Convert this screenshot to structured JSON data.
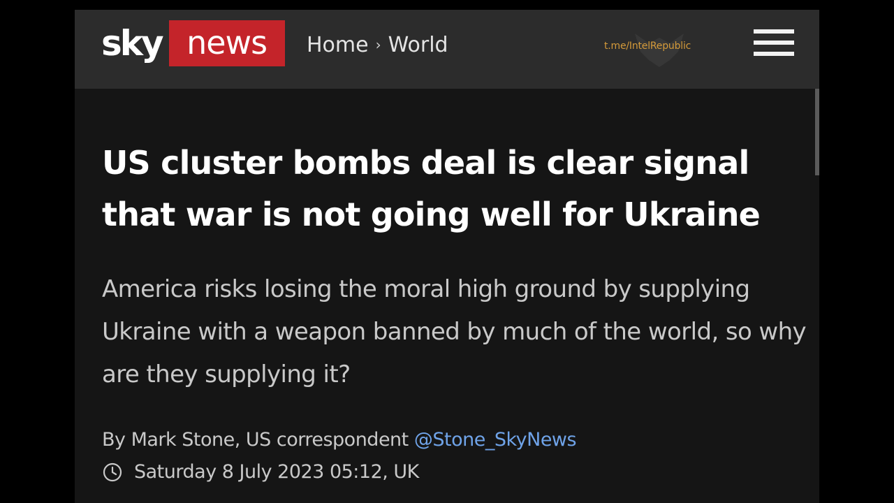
{
  "header": {
    "logo": {
      "sky": "sky",
      "news": "news"
    },
    "breadcrumb": {
      "items": [
        "Home",
        "World"
      ],
      "separator": "›"
    },
    "watermark": "t.me/IntelRepublic",
    "menu_icon": "hamburger-menu-icon"
  },
  "article": {
    "headline": "US cluster bombs deal is clear signal that war is not going well for Ukraine",
    "standfirst": "America risks losing the moral high ground by supplying Ukraine with a weapon banned by much of the world, so why are they supplying it?",
    "byline": {
      "text": "By Mark Stone, US correspondent",
      "handle": "@Stone_SkyNews"
    },
    "timestamp": "Saturday 8 July 2023 05:12, UK",
    "timestamp_icon": "clock-icon"
  },
  "colors": {
    "page_background": "#151515",
    "header_background": "#2c2c2c",
    "brand_red": "#c4242a",
    "link_blue": "#6fa3e8",
    "watermark_orange": "#d49a3a"
  }
}
